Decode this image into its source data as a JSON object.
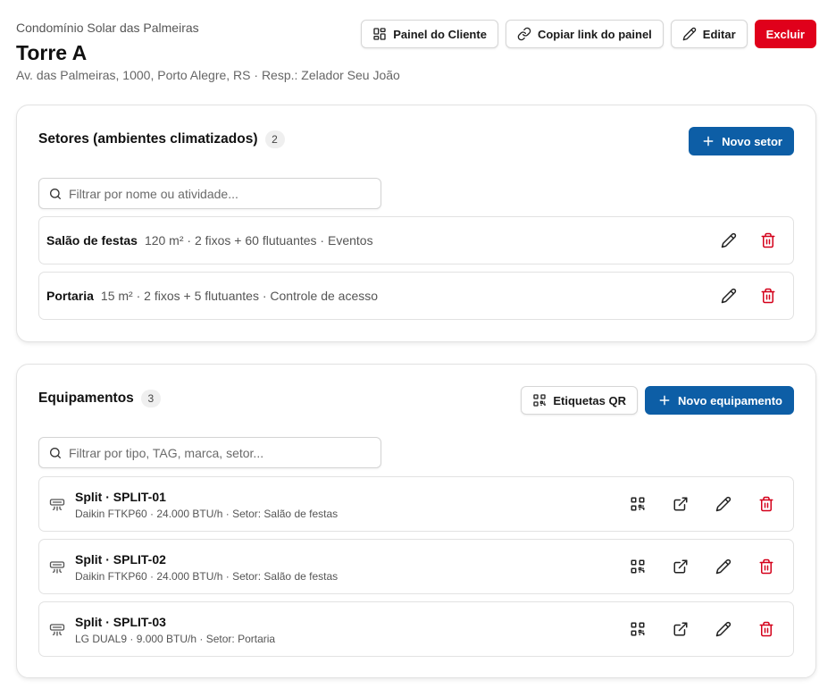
{
  "header": {
    "breadcrumb": "Condomínio Solar das Palmeiras",
    "title": "Torre A",
    "address": "Av. das Palmeiras, 1000, Porto Alegre, RS · Resp.: Zelador Seu João",
    "buttons": {
      "client_panel": "Painel do Cliente",
      "copy_link": "Copiar link do painel",
      "edit": "Editar",
      "delete": "Excluir"
    }
  },
  "sectors": {
    "title": "Setores (ambientes climatizados)",
    "count": "2",
    "new_button": "Novo setor",
    "search_placeholder": "Filtrar por nome ou atividade...",
    "items": [
      {
        "name": "Salão de festas",
        "meta": "120 m² · 2 fixos + 60 flutuantes · Eventos"
      },
      {
        "name": "Portaria",
        "meta": "15 m² · 2 fixos + 5 flutuantes · Controle de acesso"
      }
    ]
  },
  "equipment": {
    "title": "Equipamentos",
    "count": "3",
    "qr_button": "Etiquetas QR",
    "new_button": "Novo equipamento",
    "search_placeholder": "Filtrar por tipo, TAG, marca, setor...",
    "items": [
      {
        "name": "Split · SPLIT-01",
        "meta": "Daikin FTKP60 · 24.000 BTU/h · Setor: Salão de festas"
      },
      {
        "name": "Split · SPLIT-02",
        "meta": "Daikin FTKP60 · 24.000 BTU/h · Setor: Salão de festas"
      },
      {
        "name": "Split · SPLIT-03",
        "meta": "LG DUAL9 · 9.000 BTU/h · Setor: Portaria"
      }
    ]
  },
  "colors": {
    "primary": "#0d5ea6",
    "danger": "#e0001b",
    "delete_icon": "#d4001a"
  },
  "icons": [
    "grid-icon",
    "link-icon",
    "pencil-icon",
    "plus-icon",
    "search-icon",
    "trash-icon",
    "qr-code-icon",
    "external-link-icon",
    "air-conditioner-icon"
  ]
}
